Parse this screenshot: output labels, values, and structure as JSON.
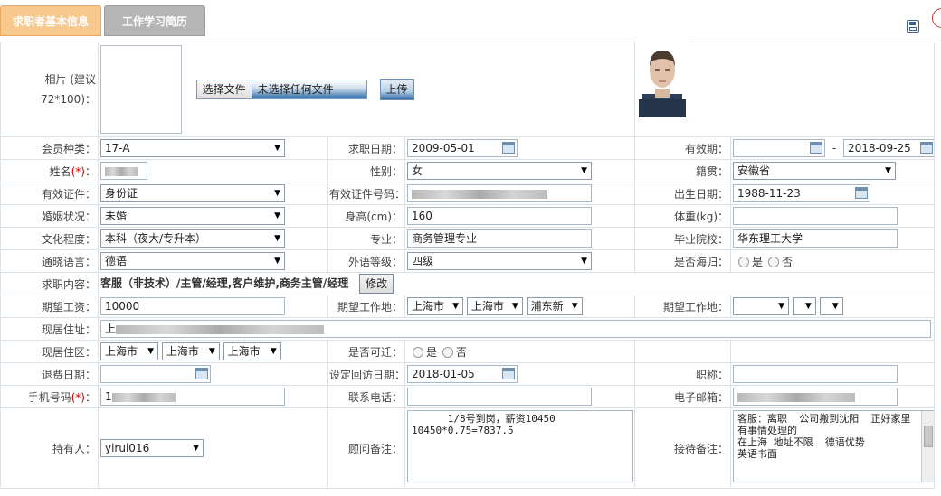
{
  "tabs": {
    "basic": "求职者基本信息",
    "history": "工作学习简历"
  },
  "photo": {
    "label_line1": "相片 (建议",
    "label_line2": "72*100)：",
    "choose_file": "选择文件",
    "no_file": "未选择任何文件",
    "upload": "上传"
  },
  "fields": {
    "member_type": {
      "label": "会员种类：",
      "value": "17-A"
    },
    "apply_date": {
      "label": "求职日期：",
      "value": "2009-05-01"
    },
    "valid_period": {
      "label": "有效期：",
      "from": "",
      "dash": "-",
      "to": "2018-09-25"
    },
    "name": {
      "label": "姓名",
      "req": "(*)",
      "colon": "："
    },
    "gender": {
      "label": "性别：",
      "value": "女"
    },
    "native": {
      "label": "籍贯：",
      "value": "安徽省"
    },
    "id_type": {
      "label": "有效证件：",
      "value": "身份证"
    },
    "id_number": {
      "label": "有效证件号码："
    },
    "birth": {
      "label": "出生日期：",
      "value": "1988-11-23"
    },
    "marital": {
      "label": "婚姻状况：",
      "value": "未婚"
    },
    "height": {
      "label": "身高(cm)：",
      "value": "160"
    },
    "weight": {
      "label": "体重(kg)：",
      "value": ""
    },
    "education": {
      "label": "文化程度：",
      "value": "本科（夜大/专升本）"
    },
    "major": {
      "label": "专业：",
      "value": "商务管理专业"
    },
    "school": {
      "label": "毕业院校：",
      "value": "华东理工大学"
    },
    "language": {
      "label": "通晓语言：",
      "value": "德语"
    },
    "lang_level": {
      "label": "外语等级：",
      "value": "四级"
    },
    "returnee": {
      "label": "是否海归：",
      "yes": "是",
      "no": "否"
    },
    "job_content": {
      "label": "求职内容：",
      "value": "客服（非技术）/主管/经理,客户维护,商务主管/经理",
      "edit": "修改"
    },
    "salary": {
      "label": "期望工资：",
      "value": "10000"
    },
    "work_place": {
      "label": "期望工作地：",
      "p1": "上海市",
      "p2": "上海市",
      "p3": "浦东新"
    },
    "work_place2": {
      "label": "期望工作地："
    },
    "address": {
      "label": "现居住址：",
      "prefix": "上"
    },
    "area": {
      "label": "现居住区：",
      "p1": "上海市",
      "p2": "上海市",
      "p3": "上海市"
    },
    "relocate": {
      "label": "是否可迁：",
      "yes": "是",
      "no": "否"
    },
    "refund_date": {
      "label": "退费日期："
    },
    "revisit_date": {
      "label": "设定回访日期：",
      "value": "2018-01-05"
    },
    "title": {
      "label": "职称："
    },
    "mobile": {
      "label": "手机号码",
      "req": "(*)",
      "colon": "：",
      "prefix": "1"
    },
    "phone": {
      "label": "联系电话："
    },
    "email": {
      "label": "电子邮箱："
    },
    "holder": {
      "label": "持有人：",
      "value": "yirui016"
    },
    "advisor_note": {
      "label": "顾问备注：",
      "value": "      1/8号到岗，薪资10450\n10450*0.75=7837.5"
    },
    "reception_note": {
      "label": "接待备注：",
      "value": "客服：离职  公司搬到沈阳  正好家里有事情处理的\n在上海 地址不限  德语优势\n英语书面"
    }
  }
}
